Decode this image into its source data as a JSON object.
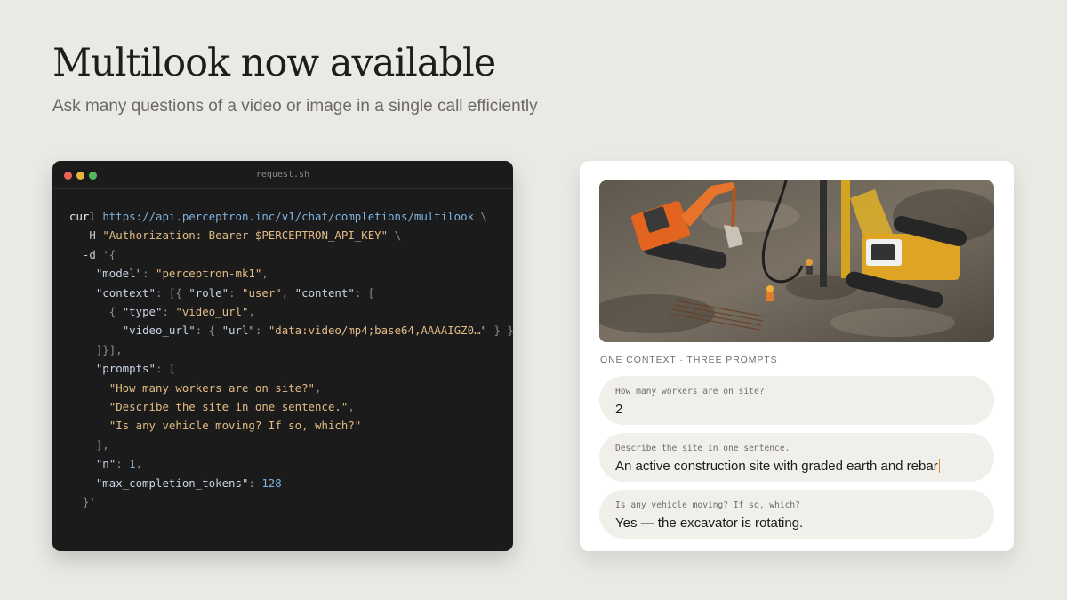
{
  "hero": {
    "title": "Multilook now available",
    "subtitle": "Ask many questions of a video or image in a single call efficiently"
  },
  "terminal": {
    "filename": "request.sh",
    "code": {
      "cmd": "curl",
      "url": "https://api.perceptron.inc/v1/chat/completions/multilook",
      "header_flag": "-H",
      "header_value": "\"Authorization: Bearer $PERCEPTRON_API_KEY\"",
      "data_flag": "-d",
      "data_open": "'{",
      "key_model": "\"model\"",
      "val_model": "\"perceptron-mk1\"",
      "key_context": "\"context\"",
      "key_role": "\"role\"",
      "val_role": "\"user\"",
      "key_content": "\"content\"",
      "key_type": "\"type\"",
      "val_type": "\"video_url\"",
      "key_video_url": "\"video_url\"",
      "key_url": "\"url\"",
      "val_url": "\"data:video/mp4;base64,AAAAIGZ0…\"",
      "key_prompts": "\"prompts\"",
      "prompt_1": "\"How many workers are on site?\"",
      "prompt_2": "\"Describe the site in one sentence.\"",
      "prompt_3": "\"Is any vehicle moving? If so, which?\"",
      "key_n": "\"n\"",
      "val_n": "1",
      "key_max_tokens": "\"max_completion_tokens\"",
      "val_max_tokens": "128",
      "data_close": "}'"
    }
  },
  "results": {
    "caption": "ONE CONTEXT · THREE PROMPTS",
    "items": [
      {
        "question": "How many workers are on site?",
        "answer": "2"
      },
      {
        "question": "Describe the site in one sentence.",
        "answer": "An active construction site with graded earth and rebar"
      },
      {
        "question": "Is any vehicle moving? If so, which?",
        "answer": "Yes — the excavator is rotating."
      }
    ]
  },
  "colors": {
    "background": "#ebe9e4",
    "terminal_bg": "#1b1b1b",
    "string": "#e3bb84",
    "url": "#7fb3e0",
    "bubble": "#f1efea",
    "cursor": "#e08a2e"
  },
  "icons": [
    "close-dot-icon",
    "minimize-dot-icon",
    "maximize-dot-icon",
    "text-cursor-icon"
  ]
}
